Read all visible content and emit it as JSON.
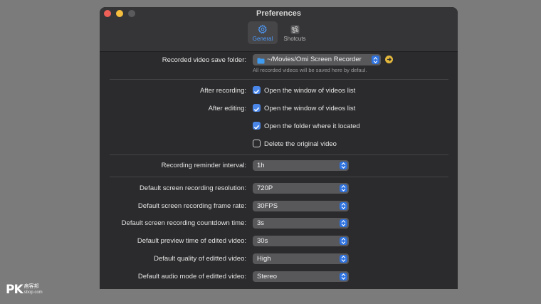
{
  "window": {
    "title": "Preferences"
  },
  "tabs": [
    {
      "label": "General",
      "icon": "gear-icon",
      "active": true
    },
    {
      "label": "Shotcuts",
      "icon": "command-key-icon",
      "active": false
    }
  ],
  "save_folder": {
    "label": "Recorded video save folder:",
    "value": "~/Movies/Omi Screen Recorder",
    "hint": "All recorded videos will be saved here by defaul."
  },
  "after_recording": {
    "label": "After recording:",
    "option": "Open the window of videos list",
    "checked": true
  },
  "after_editing": {
    "label": "After editing:",
    "options": [
      {
        "text": "Open the window of videos list",
        "checked": true
      },
      {
        "text": "Open the folder where it located",
        "checked": true
      },
      {
        "text": "Delete the original video",
        "checked": false
      }
    ]
  },
  "reminder": {
    "label": "Recording reminder interval:",
    "value": "1h"
  },
  "defaults": [
    {
      "label": "Default screen recording resolution:",
      "value": "720P"
    },
    {
      "label": "Default screen recording frame rate:",
      "value": "30FPS"
    },
    {
      "label": "Default screen recording countdown time:",
      "value": "3s"
    },
    {
      "label": "Default preview time of edited video:",
      "value": "30s"
    },
    {
      "label": "Default quality of editted video:",
      "value": "High"
    },
    {
      "label": "Default audio mode of editted video:",
      "value": "Stereo"
    }
  ],
  "watermark": {
    "logo": "PK",
    "name": "痞客邦",
    "site": "sbop.com"
  },
  "colors": {
    "accent": "#2f73e0",
    "checkbox": "#4a86e8",
    "window_bg": "#2b2b2d",
    "tab_active_text": "#4d9cff"
  }
}
